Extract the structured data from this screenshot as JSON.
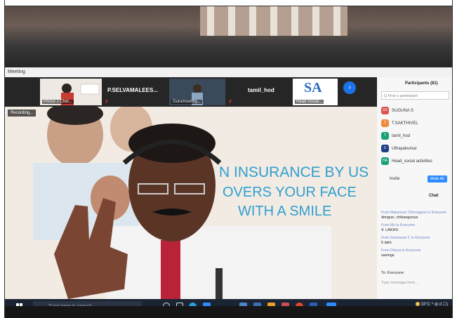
{
  "window": {
    "title": "Meeting"
  },
  "thumbnails": [
    {
      "name": "Prince J Chel...",
      "caption": "SYMPOSIUM"
    },
    {
      "name": "P.SELVAMALEES..."
    },
    {
      "name": "Gurumoorthy..."
    },
    {
      "name": "tamil_hod"
    },
    {
      "name": "Head Social...",
      "logo": "SA"
    }
  ],
  "recording": {
    "label": "Recording..."
  },
  "slide": {
    "line1": "N INSURANCE BY US",
    "line2": "OVERS YOUR FACE",
    "line3": "WITH A SMILE"
  },
  "participants": {
    "title": "Participants (81)",
    "search_placeholder": "Q Find a participant",
    "items": [
      {
        "initials": "SS",
        "name": "SUGUNA S",
        "color": "#d9534f"
      },
      {
        "initials": "T",
        "name": "T.SAKTHIVEL",
        "color": "#f0883e"
      },
      {
        "initials": "T",
        "name": "tamil_hod",
        "color": "#1aa07a"
      },
      {
        "initials": "U",
        "name": "Uthayakumar",
        "color": "#1f3f86"
      },
      {
        "initials": "HA",
        "name": "Head_social activities",
        "color": "#1aa07a"
      }
    ],
    "invite_label": "Invite",
    "mute_all_label": "Mute All"
  },
  "chat": {
    "title": "Chat",
    "messages": [
      {
        "from": "From Malaravan Chinnappan to Everyone",
        "text": "dengue, chikangunya"
      },
      {
        "from": "From Me to Everyone",
        "text": "4. LAKHS"
      },
      {
        "from": "From Srinivasan C to Everyone",
        "text": "5 lakh"
      },
      {
        "from": "From Dhivya to Everyone",
        "text": "savings"
      }
    ],
    "to_label": "To: Everyone",
    "input_placeholder": "Type message here..."
  },
  "taskbar": {
    "search_placeholder": "Type here to search",
    "temperature": "33°C",
    "tray_icons": "^ ф d ☐)"
  }
}
